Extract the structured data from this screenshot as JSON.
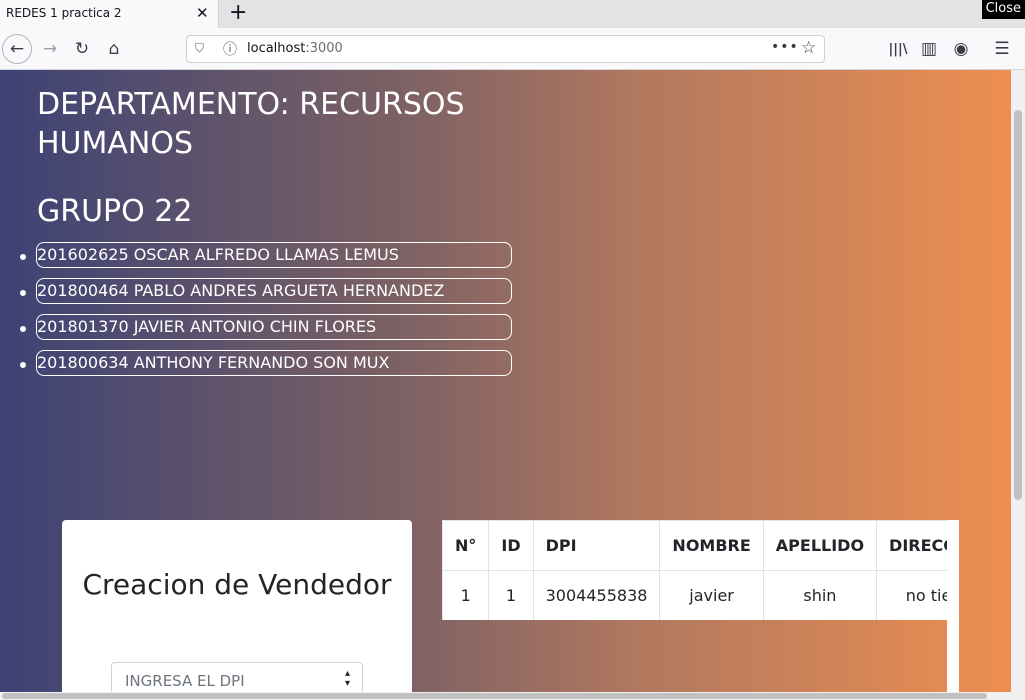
{
  "browser": {
    "tab_title": "REDES 1 practica 2",
    "tab_close": "✕",
    "new_tab": "+",
    "close_overlay": "Close",
    "url_host": "localhost",
    "url_port": ":3000",
    "url_more": "•••",
    "icons": {
      "back": "←",
      "forward": "→",
      "reload": "↻",
      "home": "⌂",
      "shield": "⛉",
      "info": "ⓘ",
      "bookmark": "☆",
      "library": "|||\\",
      "sidebar": "▥",
      "account": "◉",
      "menu": "☰"
    }
  },
  "page": {
    "department_title": "DEPARTAMENTO: RECURSOS HUMANOS",
    "group_title": "GRUPO 22",
    "members": [
      "201602625 OSCAR ALFREDO LLAMAS LEMUS",
      "201800464 PABLO ANDRES ARGUETA HERNANDEZ",
      "201801370 JAVIER ANTONIO CHIN FLORES",
      "201800634 ANTHONY FERNANDO SON MUX"
    ],
    "form": {
      "title": "Creacion de Vendedor",
      "dpi_placeholder": "INGRESA EL DPI"
    },
    "table": {
      "headers": [
        "N°",
        "ID",
        "DPI",
        "NOMBRE",
        "APELLIDO",
        "DIRECCION"
      ],
      "rows": [
        [
          "1",
          "1",
          "3004455838",
          "javier",
          "shin",
          "no tiene"
        ]
      ]
    }
  },
  "colors": {
    "gradient_start": "#3d4275",
    "gradient_end": "#f08f50"
  }
}
